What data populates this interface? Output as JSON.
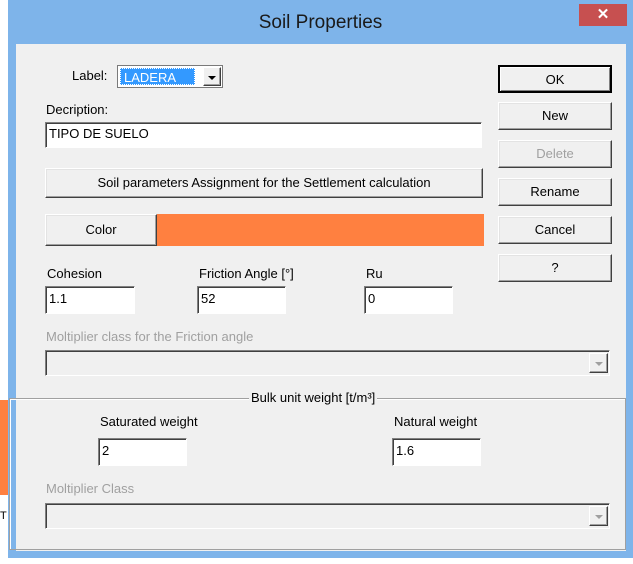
{
  "window": {
    "title": "Soil Properties",
    "close_glyph": "✕"
  },
  "background": {
    "stub_text": "T"
  },
  "label": {
    "caption": "Label:",
    "value": "LADERA"
  },
  "description": {
    "caption": "Decription:",
    "value": "TIPO DE SUELO"
  },
  "settlement_button": "Soil parameters Assignment for the Settlement calculation",
  "color": {
    "button_label": "Color",
    "swatch": "#ff8040"
  },
  "params": {
    "cohesion": {
      "caption": "Cohesion",
      "value": "1.1"
    },
    "friction": {
      "caption": "Friction Angle [°]",
      "value": "52"
    },
    "ru": {
      "caption": "Ru",
      "value": "0"
    }
  },
  "friction_multiplier": {
    "caption": "Moltiplier class for the Friction angle",
    "value": ""
  },
  "bulk": {
    "legend": "Bulk unit weight [t/m³]",
    "saturated": {
      "caption": "Saturated weight",
      "value": "2"
    },
    "natural": {
      "caption": "Natural weight",
      "value": "1.6"
    },
    "multiplier": {
      "caption": "Moltiplier Class",
      "value": ""
    }
  },
  "buttons": {
    "ok": "OK",
    "new": "New",
    "delete": "Delete",
    "rename": "Rename",
    "cancel": "Cancel",
    "help": "?"
  },
  "colors": {
    "titlebar": "#7eb4ea",
    "close": "#c75050",
    "swatch": "#ff8040",
    "selection": "#3399ff"
  }
}
